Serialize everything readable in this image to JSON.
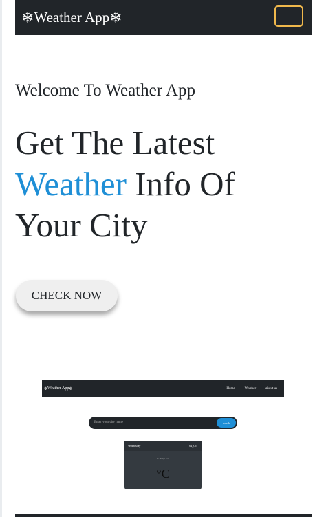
{
  "navbar": {
    "brand_icon_left": "❄",
    "brand_text": "Weather App",
    "brand_icon_right": "❄"
  },
  "hero": {
    "welcome": "Welcome To Weather App",
    "headline_line1": "Get The Latest",
    "headline_accent": "Weather",
    "headline_line2_rest": " Info Of",
    "headline_line3": "Your City",
    "cta_label": "CHECK NOW"
  },
  "preview": {
    "brand_icon_left": "❄",
    "brand_text": "Weather App",
    "brand_icon_right": "❄",
    "nav_links": [
      "Home",
      "Weather",
      "about us"
    ],
    "search_placeholder": "Enter your city name",
    "search_button": "search",
    "card_day": "Wednesday",
    "card_date": "04_Oct",
    "card_status": "no change here",
    "card_temp": "°C"
  },
  "colors": {
    "nav_bg": "#212529",
    "accent": "#1f8fd6",
    "toggler_border": "#f0b84c"
  }
}
